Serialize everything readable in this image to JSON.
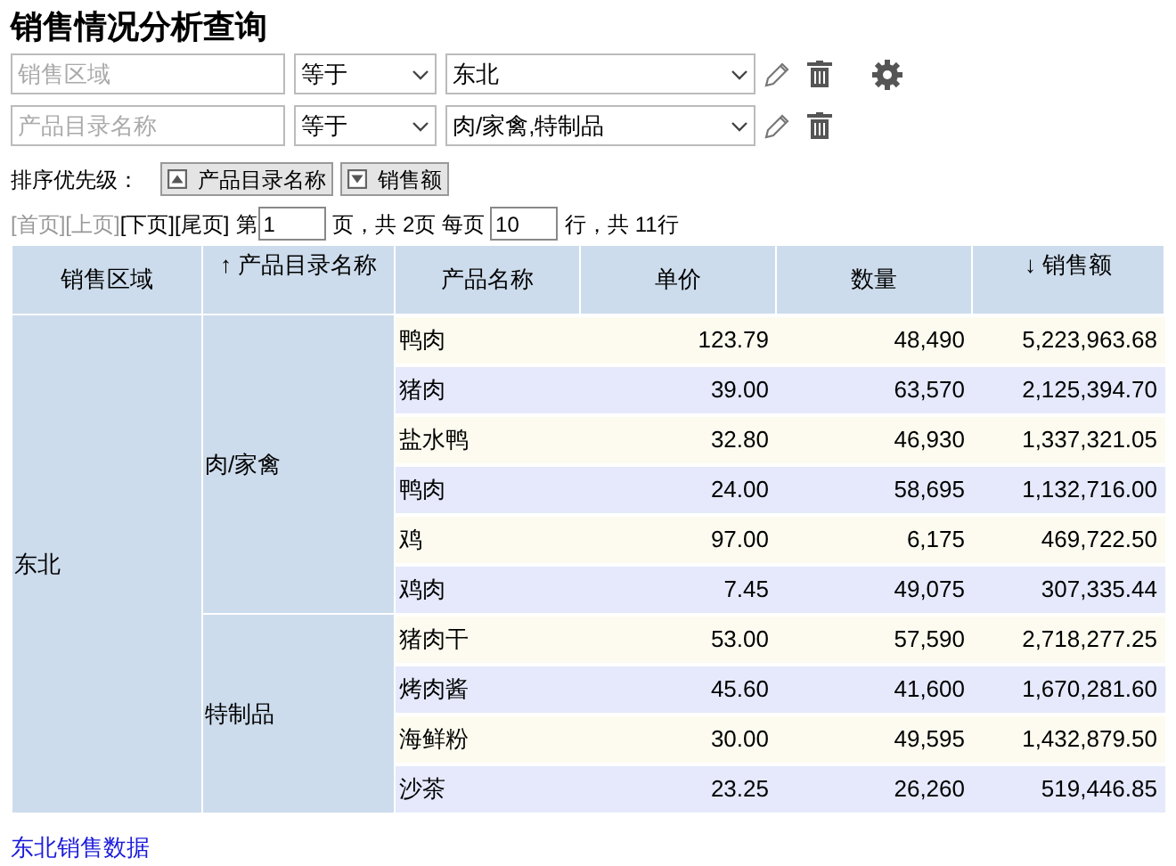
{
  "title": "销售情况分析查询",
  "filters": [
    {
      "field_placeholder": "销售区域",
      "operator": "等于",
      "value": "东北"
    },
    {
      "field_placeholder": "产品目录名称",
      "operator": "等于",
      "value": "肉/家禽,特制品"
    }
  ],
  "sort_priority": {
    "label": "排序优先级：",
    "items": [
      {
        "label": "产品目录名称",
        "ascending": true
      },
      {
        "label": "销售额",
        "ascending": false
      }
    ]
  },
  "pager": {
    "links": [
      {
        "label": "[首页]",
        "disabled": true
      },
      {
        "label": "[上页]",
        "disabled": true
      },
      {
        "label": "[下页]",
        "disabled": false
      },
      {
        "label": "[尾页]",
        "disabled": false
      }
    ],
    "page_prefix": "第",
    "page_value": "1",
    "page_suffix": "页，共 2页 每页",
    "rows_value": "10",
    "rows_suffix": "行，共 11行"
  },
  "table": {
    "columns": [
      {
        "label": "销售区域"
      },
      {
        "label": "产品目录名称",
        "arrow": "↑"
      },
      {
        "label": "产品名称"
      },
      {
        "label": "单价"
      },
      {
        "label": "数量"
      },
      {
        "label": "销售额",
        "arrow": "↓"
      }
    ],
    "groups": [
      {
        "region": "东北",
        "categories": [
          {
            "name": "肉/家禽",
            "products": [
              {
                "name": "鸭肉",
                "price": "123.79",
                "quantity": "48,490",
                "sales": "5,223,963.68"
              },
              {
                "name": "猪肉",
                "price": "39.00",
                "quantity": "63,570",
                "sales": "2,125,394.70"
              },
              {
                "name": "盐水鸭",
                "price": "32.80",
                "quantity": "46,930",
                "sales": "1,337,321.05"
              },
              {
                "name": "鸭肉",
                "price": "24.00",
                "quantity": "58,695",
                "sales": "1,132,716.00"
              },
              {
                "name": "鸡",
                "price": "97.00",
                "quantity": "6,175",
                "sales": "469,722.50"
              },
              {
                "name": "鸡肉",
                "price": "7.45",
                "quantity": "49,075",
                "sales": "307,335.44"
              }
            ]
          },
          {
            "name": "特制品",
            "products": [
              {
                "name": "猪肉干",
                "price": "53.00",
                "quantity": "57,590",
                "sales": "2,718,277.25"
              },
              {
                "name": "烤肉酱",
                "price": "45.60",
                "quantity": "41,600",
                "sales": "1,670,281.60"
              },
              {
                "name": "海鲜粉",
                "price": "30.00",
                "quantity": "49,595",
                "sales": "1,432,879.50"
              },
              {
                "name": "沙茶",
                "price": "23.25",
                "quantity": "26,260",
                "sales": "519,446.85"
              }
            ]
          }
        ]
      }
    ]
  },
  "footer_link": "东北销售数据"
}
